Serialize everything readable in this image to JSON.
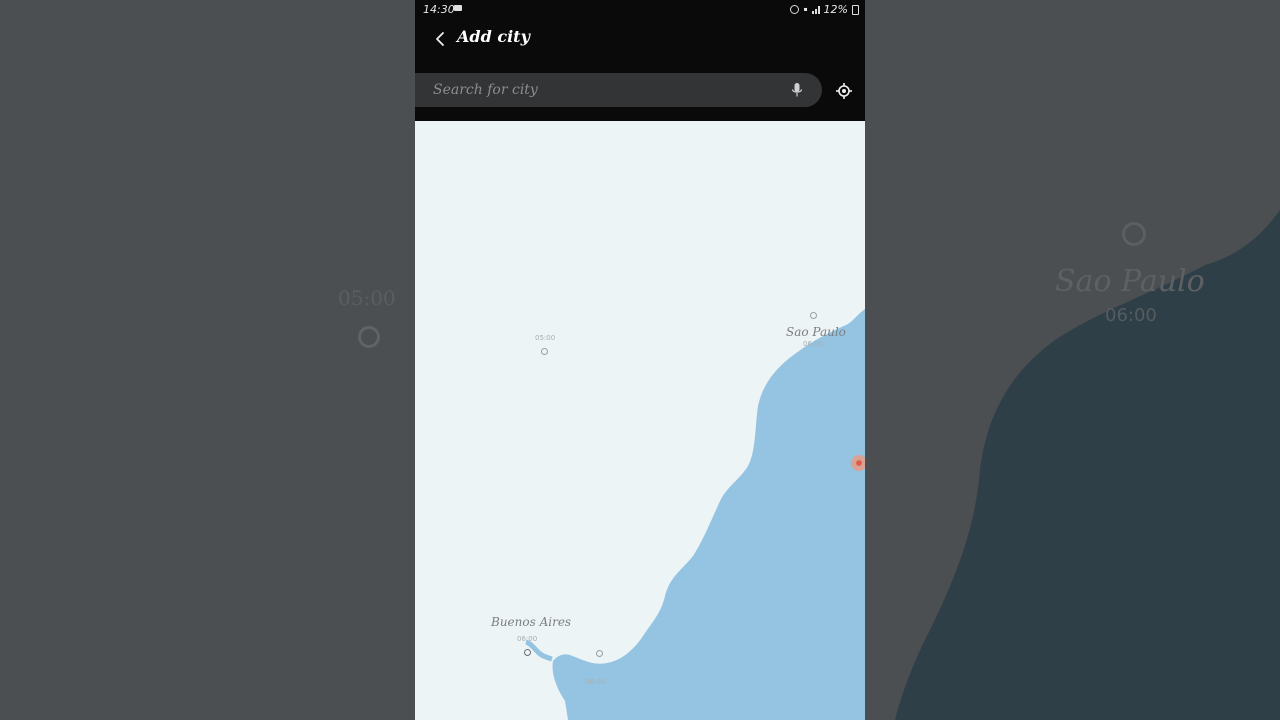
{
  "status_bar": {
    "time": "14:30",
    "battery": "12%"
  },
  "header": {
    "title": "Add city"
  },
  "search": {
    "placeholder": "Search for city"
  },
  "map": {
    "cities": [
      {
        "name": "Sao Paulo",
        "time": "06:00"
      },
      {
        "name": "Buenos Aires",
        "time": "06:00"
      }
    ],
    "time_labels": [
      {
        "time": "05:00"
      },
      {
        "time": "06:00"
      }
    ]
  },
  "background": {
    "left_time": "05:00",
    "right_city": "Sao Paulo",
    "right_time": "06:00"
  },
  "colors": {
    "ocean": "#94c4e2",
    "land": "#edf4f6",
    "toolbar": "#0a0a0a",
    "search_bg": "#333435",
    "marker": "#e05a4a"
  }
}
